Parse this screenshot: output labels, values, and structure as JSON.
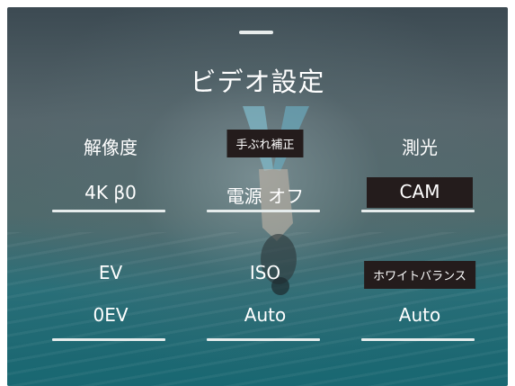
{
  "header": {
    "title": "ビデオ設定"
  },
  "settings": [
    {
      "label": "解像度",
      "value": "4K β0"
    },
    {
      "label": "手ぶれ補正",
      "value": "電源 オフ"
    },
    {
      "label": "測光",
      "value": "CAM"
    },
    {
      "label": "EV",
      "value": "0EV"
    },
    {
      "label": "ISO",
      "value": "Auto"
    },
    {
      "label": "ホワイトバランス",
      "value": "Auto"
    }
  ],
  "colors": {
    "label_box": "#241c1c",
    "text": "#ffffff",
    "underline": "#e6ecec"
  }
}
